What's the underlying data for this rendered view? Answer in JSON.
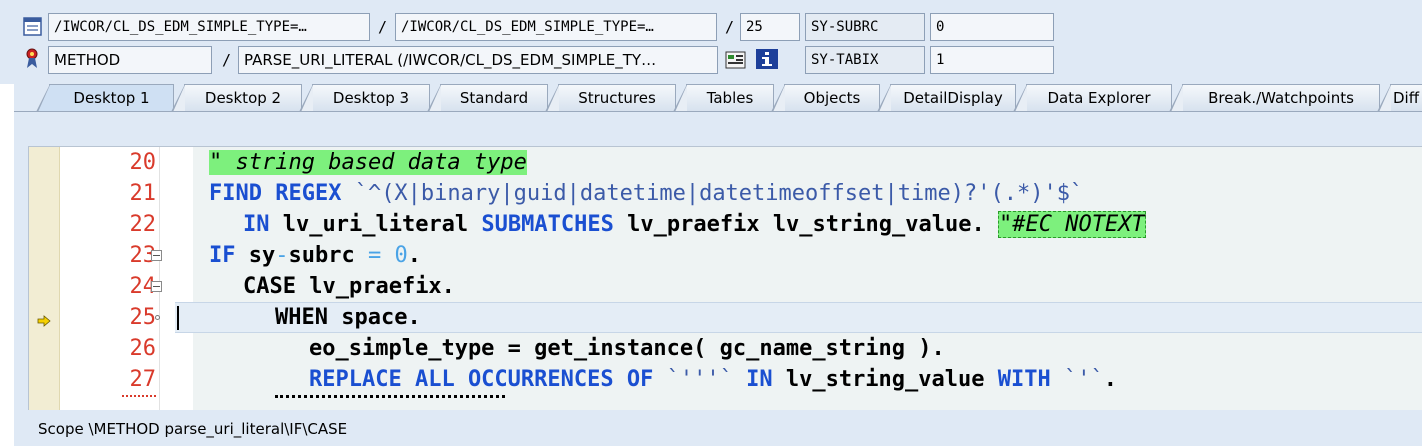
{
  "header": {
    "row1": {
      "field1": "/IWCOR/CL_DS_EDM_SIMPLE_TYPE=…",
      "sep1": "/",
      "field2": "/IWCOR/CL_DS_EDM_SIMPLE_TYPE=…",
      "sep2": "/",
      "line": "25",
      "sysvar_name": "SY-SUBRC",
      "sysvar_value": "0"
    },
    "row2": {
      "event_type": "METHOD",
      "sep": "/",
      "event_name": "PARSE_URI_LITERAL (/IWCOR/CL_DS_EDM_SIMPLE_TY…",
      "sysvar_name": "SY-TABIX",
      "sysvar_value": "1"
    }
  },
  "tabs": [
    {
      "label": "Desktop 1",
      "active": true
    },
    {
      "label": "Desktop 2"
    },
    {
      "label": "Desktop 3"
    },
    {
      "label": "Standard"
    },
    {
      "label": "Structures"
    },
    {
      "label": "Tables"
    },
    {
      "label": "Objects"
    },
    {
      "label": "DetailDisplay"
    },
    {
      "label": "Data Explorer"
    },
    {
      "label": "Break./Watchpoints"
    },
    {
      "label": "Diff"
    }
  ],
  "editor": {
    "lines": [
      {
        "num": "20"
      },
      {
        "num": "21"
      },
      {
        "num": "22"
      },
      {
        "num": "23"
      },
      {
        "num": "24"
      },
      {
        "num": "25"
      },
      {
        "num": "26"
      },
      {
        "num": "27"
      }
    ],
    "code": {
      "l20_comment": "\" string based data type",
      "l21_kw1": "FIND REGEX",
      "l21_str": " `^(X|binary|guid|datetime|datetimeoffset|time)?'(.*)'$`",
      "l22_kw1": "IN",
      "l22_t1": " lv_uri_literal ",
      "l22_kw2": "SUBMATCHES",
      "l22_t2": " lv_praefix lv_string_value. ",
      "l22_comment": "\"#EC NOTEXT",
      "l23_kw": "IF",
      "l23_t1": " sy",
      "l23_op": "-",
      "l23_t2": "subrc ",
      "l23_eq": "=",
      "l23_sp": " ",
      "l23_num": "0",
      "l23_dot": ".",
      "l24_kw": "CASE",
      "l24_t": " lv_praefix.",
      "l25_kw": "WHEN",
      "l25_t": " space.",
      "l26_t1": "eo_simple_type = get_instance( gc_name_string ).",
      "l27_kw1": "REPLACE ALL OCCURRENCES OF",
      "l27_str1": " `'''` ",
      "l27_kw2": "IN",
      "l27_t": " lv_string_value ",
      "l27_kw3": "WITH",
      "l27_str2": " `'`",
      "l27_dot": "."
    }
  },
  "status": {
    "scope": "Scope \\METHOD parse_uri_literal\\IF\\CASE"
  },
  "colors": {
    "keyword": "#1a4fd1",
    "line_number": "#d93a2b",
    "comment_highlight": "#7df07d",
    "background": "#dfe9f5"
  },
  "icons": {
    "row1": "program-icon",
    "row2": "method-icon",
    "row2_a": "display-object-icon",
    "row2_b": "info-icon",
    "current_line": "execution-arrow-icon"
  }
}
